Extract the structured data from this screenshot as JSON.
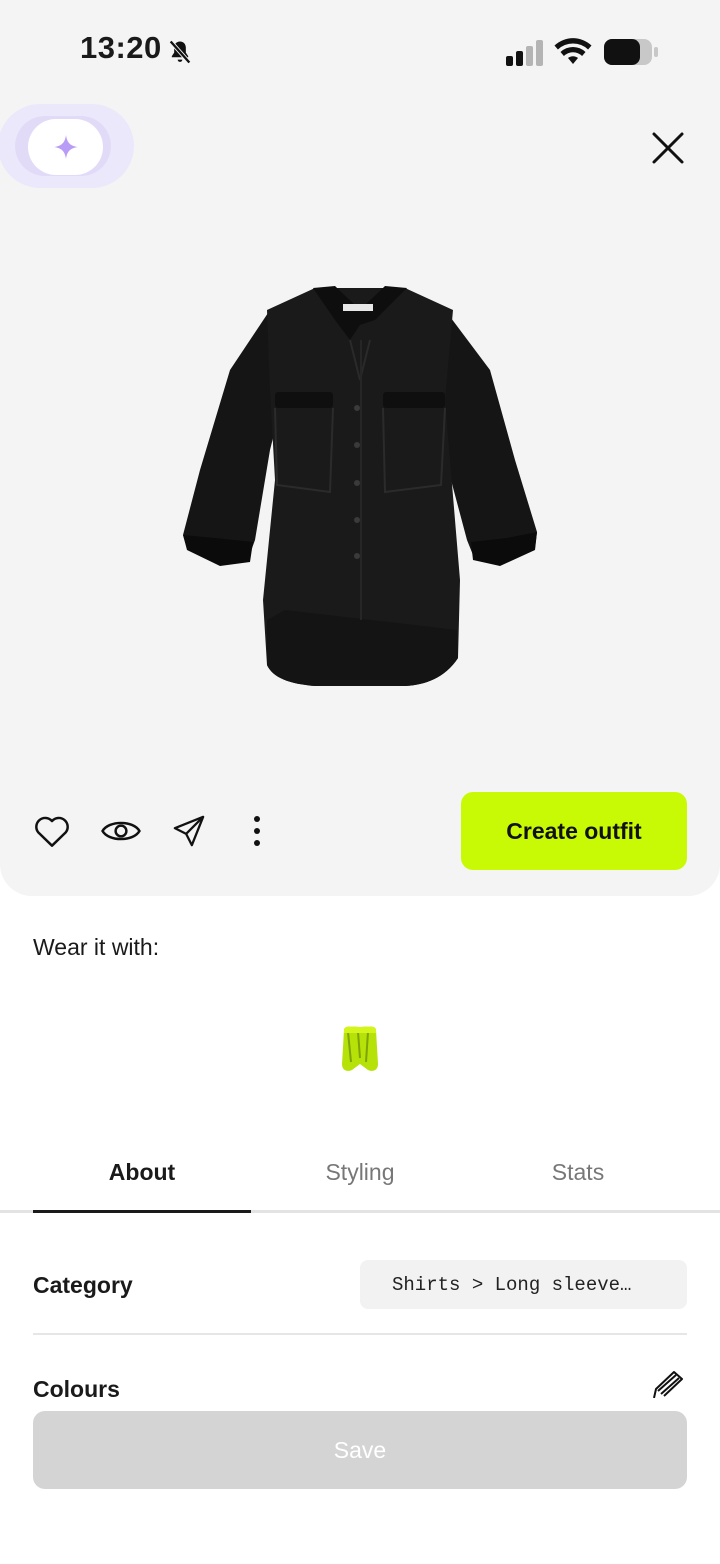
{
  "status_bar": {
    "time": "13:20"
  },
  "item": {
    "actions": {
      "favorite_icon": "heart-icon",
      "view_icon": "eye-icon",
      "share_icon": "send-icon",
      "more_icon": "more-vertical-icon",
      "create_outfit_label": "Create outfit"
    }
  },
  "wear_with": {
    "label": "Wear it with:"
  },
  "tabs": [
    {
      "label": "About",
      "active": true
    },
    {
      "label": "Styling",
      "active": false
    },
    {
      "label": "Stats",
      "active": false
    }
  ],
  "about": {
    "category_label": "Category",
    "category_value": "Shirts > Long sleeve…",
    "colours_label": "Colours"
  },
  "footer": {
    "save_label": "Save"
  },
  "colors": {
    "accent": "#c8fa05",
    "panel_bg": "#f4f4f4",
    "ai_sparkle": "#b89cf5",
    "disabled_button": "#d4d4d4"
  }
}
